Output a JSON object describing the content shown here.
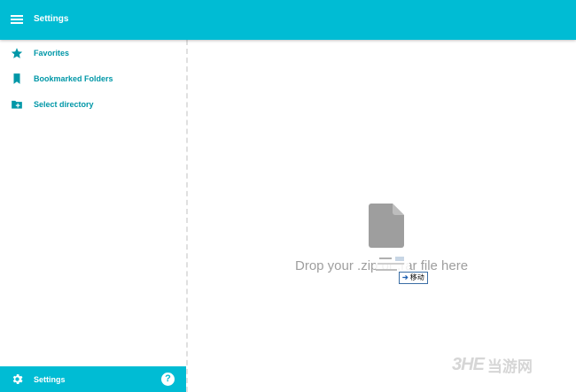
{
  "header": {
    "title": "Settings",
    "menu_icon": "hamburger-menu-icon"
  },
  "sidebar": {
    "items": [
      {
        "label": "Favorites",
        "icon": "star-icon"
      },
      {
        "label": "Bookmarked Folders",
        "icon": "bookmark-icon"
      },
      {
        "label": "Select directory",
        "icon": "folder-add-icon"
      }
    ]
  },
  "footer": {
    "label": "Settings",
    "icon": "gear-icon",
    "help_icon": "help-icon",
    "help_glyph": "?"
  },
  "main": {
    "drop_text": "Drop your .zip or .rar file here",
    "file_icon": "file-icon"
  },
  "drag_tooltip": {
    "label": "移动",
    "arrow": "➔"
  },
  "watermark": {
    "logo": "3HE",
    "text": "当游网"
  },
  "colors": {
    "accent": "#00bcd4",
    "link": "#0097a7",
    "icon": "#0097a7",
    "muted_text": "#9e9e9e",
    "file_icon": "#9e9e9e"
  }
}
